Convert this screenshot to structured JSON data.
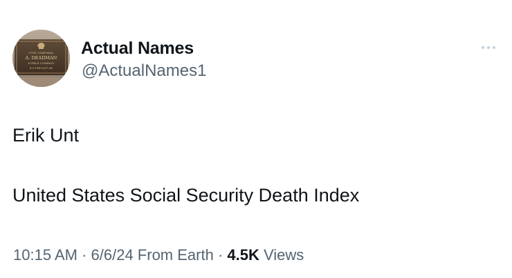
{
  "user": {
    "display_name": "Actual Names",
    "handle": "@ActualNames1",
    "avatar_icon": "memorial-plaque-avatar",
    "avatar_plaque_lines": [
      "37TH CORPORAL",
      "A. DEADMAN",
      "4 FIELD COMPANY",
      "4-5-1943 ACT AD"
    ]
  },
  "more_icon": "more-horizontal-icon",
  "tweet": {
    "lines": [
      "Erik Unt",
      "United States Social Security Death Index"
    ]
  },
  "meta": {
    "time": "10:15 AM",
    "separator1": " · ",
    "date": "6/6/24",
    "source": " From Earth",
    "separator2": " · ",
    "views_count": "4.5K",
    "views_label": " Views"
  },
  "colors": {
    "text_primary": "#0f1419",
    "text_secondary": "#536471",
    "more_dots": "#c4cfd6"
  }
}
